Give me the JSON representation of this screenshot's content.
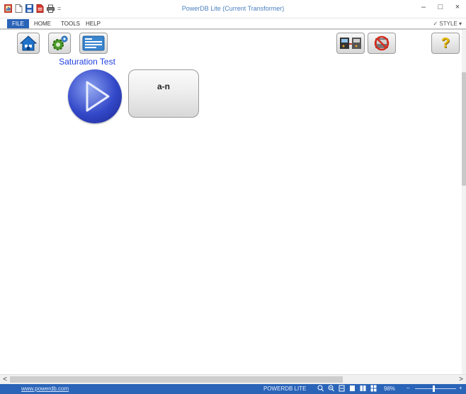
{
  "window": {
    "title": "PowerDB Lite (Current Transformer)",
    "minimize_glyph": "–",
    "maximize_glyph": "□",
    "close_glyph": "×"
  },
  "quick_access": {
    "icons": [
      "app-logo-icon",
      "new-file-icon",
      "save-icon",
      "pdf-icon",
      "print-icon"
    ],
    "overflow": "="
  },
  "ribbon": {
    "tabs": [
      {
        "label": "FILE",
        "active": true
      },
      {
        "label": "HOME",
        "active": false
      },
      {
        "label": "TOOLS",
        "active": false
      },
      {
        "label": "HELP",
        "active": false
      }
    ],
    "style_label": "✓ STYLE ▾"
  },
  "toolbar": {
    "left_icons": [
      "home-icon",
      "settings-icon",
      "form-icon"
    ],
    "right_icons": [
      "instrument-connection-icon",
      "no-connection-icon"
    ],
    "help_glyph": "?"
  },
  "test": {
    "label": "Saturation Test",
    "phase_button": "a-n"
  },
  "scrollbar": {
    "left_arrow": "<",
    "right_arrow": ">"
  },
  "status": {
    "url": "www.powerdb.com",
    "product": "POWERDB LITE",
    "icons": [
      "zoom-in-icon",
      "zoom-out-icon",
      "fit-page-icon",
      "single-page-icon",
      "two-page-icon",
      "multi-page-icon"
    ],
    "zoom": "98%",
    "zoom_minus": "–",
    "zoom_plus": "+"
  },
  "colors": {
    "accent": "#2a64b8",
    "test_label": "#1f3fe0",
    "play_button": "#3348c8"
  }
}
